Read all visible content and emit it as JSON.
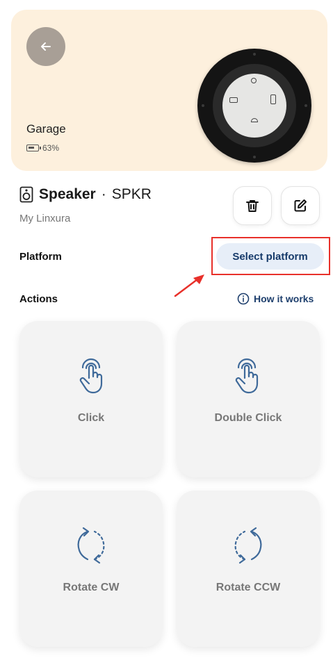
{
  "hero": {
    "title": "Garage",
    "battery": "63%",
    "back_icon": "arrow-left-icon",
    "background": "#fdf0dd"
  },
  "device": {
    "name": "Speaker",
    "separator": "·",
    "type": "SPKR",
    "subtitle": "My Linxura",
    "icon": "speaker-icon"
  },
  "toolbar": {
    "delete_icon": "trash-icon",
    "edit_icon": "edit-icon"
  },
  "platform": {
    "label": "Platform",
    "button_label": "Select platform",
    "highlight_color": "#e8302a"
  },
  "actions": {
    "label": "Actions",
    "how_label": "How it works",
    "items": [
      {
        "label": "Click",
        "icon": "tap-icon"
      },
      {
        "label": "Double Click",
        "icon": "double-tap-icon"
      },
      {
        "label": "Rotate CW",
        "icon": "rotate-cw-icon"
      },
      {
        "label": "Rotate CCW",
        "icon": "rotate-ccw-icon"
      }
    ]
  },
  "colors": {
    "accent": "#1e3f6d",
    "icon_stroke": "#3f6a9a"
  }
}
